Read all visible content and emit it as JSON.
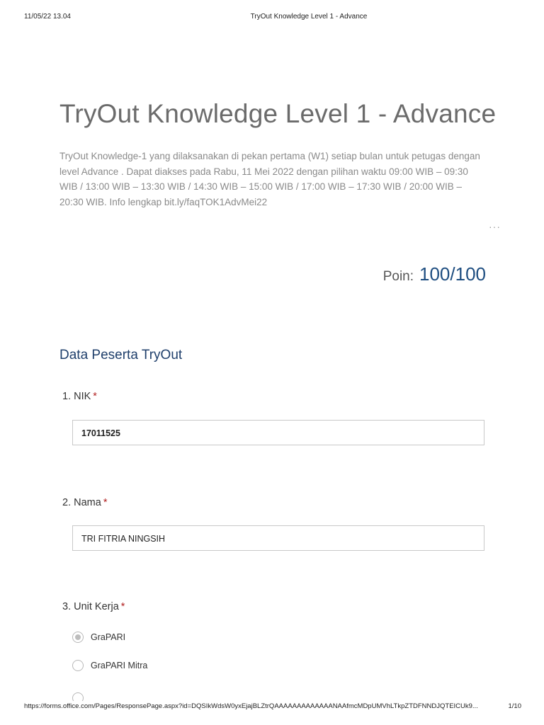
{
  "print_header": {
    "date": "11/05/22 13.04",
    "title": "TryOut Knowledge Level 1 - Advance"
  },
  "form": {
    "title": "TryOut Knowledge Level 1 - Advance",
    "description": "TryOut Knowledge-1 yang dilaksanakan di pekan pertama (W1) setiap bulan untuk petugas dengan level Advance . Dapat diakses pada Rabu, 11 Mei 2022 dengan pilihan waktu 09:00 WIB – 09:30 WIB / 13:00 WIB – 13:30 WIB / 14:30 WIB – 15:00 WIB / 17:00 WIB – 17:30 WIB / 20:00 WIB – 20:30 WIB. Info lengkap bit.ly/faqTOK1AdvMei22",
    "more_icon": "ellipsis-icon"
  },
  "score": {
    "label": "Poin:",
    "value": "100/100"
  },
  "section": {
    "title": "Data Peserta TryOut"
  },
  "questions": [
    {
      "label": "1. NIK",
      "required": "*",
      "answer": "17011525"
    },
    {
      "label": "2. Nama",
      "required": "*",
      "answer": "TRI FITRIA NINGSIH"
    },
    {
      "label": "3. Unit Kerja",
      "required": "*",
      "options": [
        {
          "label": "GraPARI",
          "selected": true
        },
        {
          "label": "GraPARI Mitra",
          "selected": false
        }
      ]
    }
  ],
  "print_footer": {
    "url": "https://forms.office.com/Pages/ResponsePage.aspx?id=DQSIkWdsW0yxEjajBLZtrQAAAAAAAAAAAAANAAfmcMDpUMVhLTkpZTDFNNDJQTEICUk9...",
    "page": "1/10"
  },
  "colors": {
    "accent": "#1d4d80",
    "section_title": "#1f3f6b",
    "required": "#b22222",
    "title_gray": "#6b6b6b"
  }
}
